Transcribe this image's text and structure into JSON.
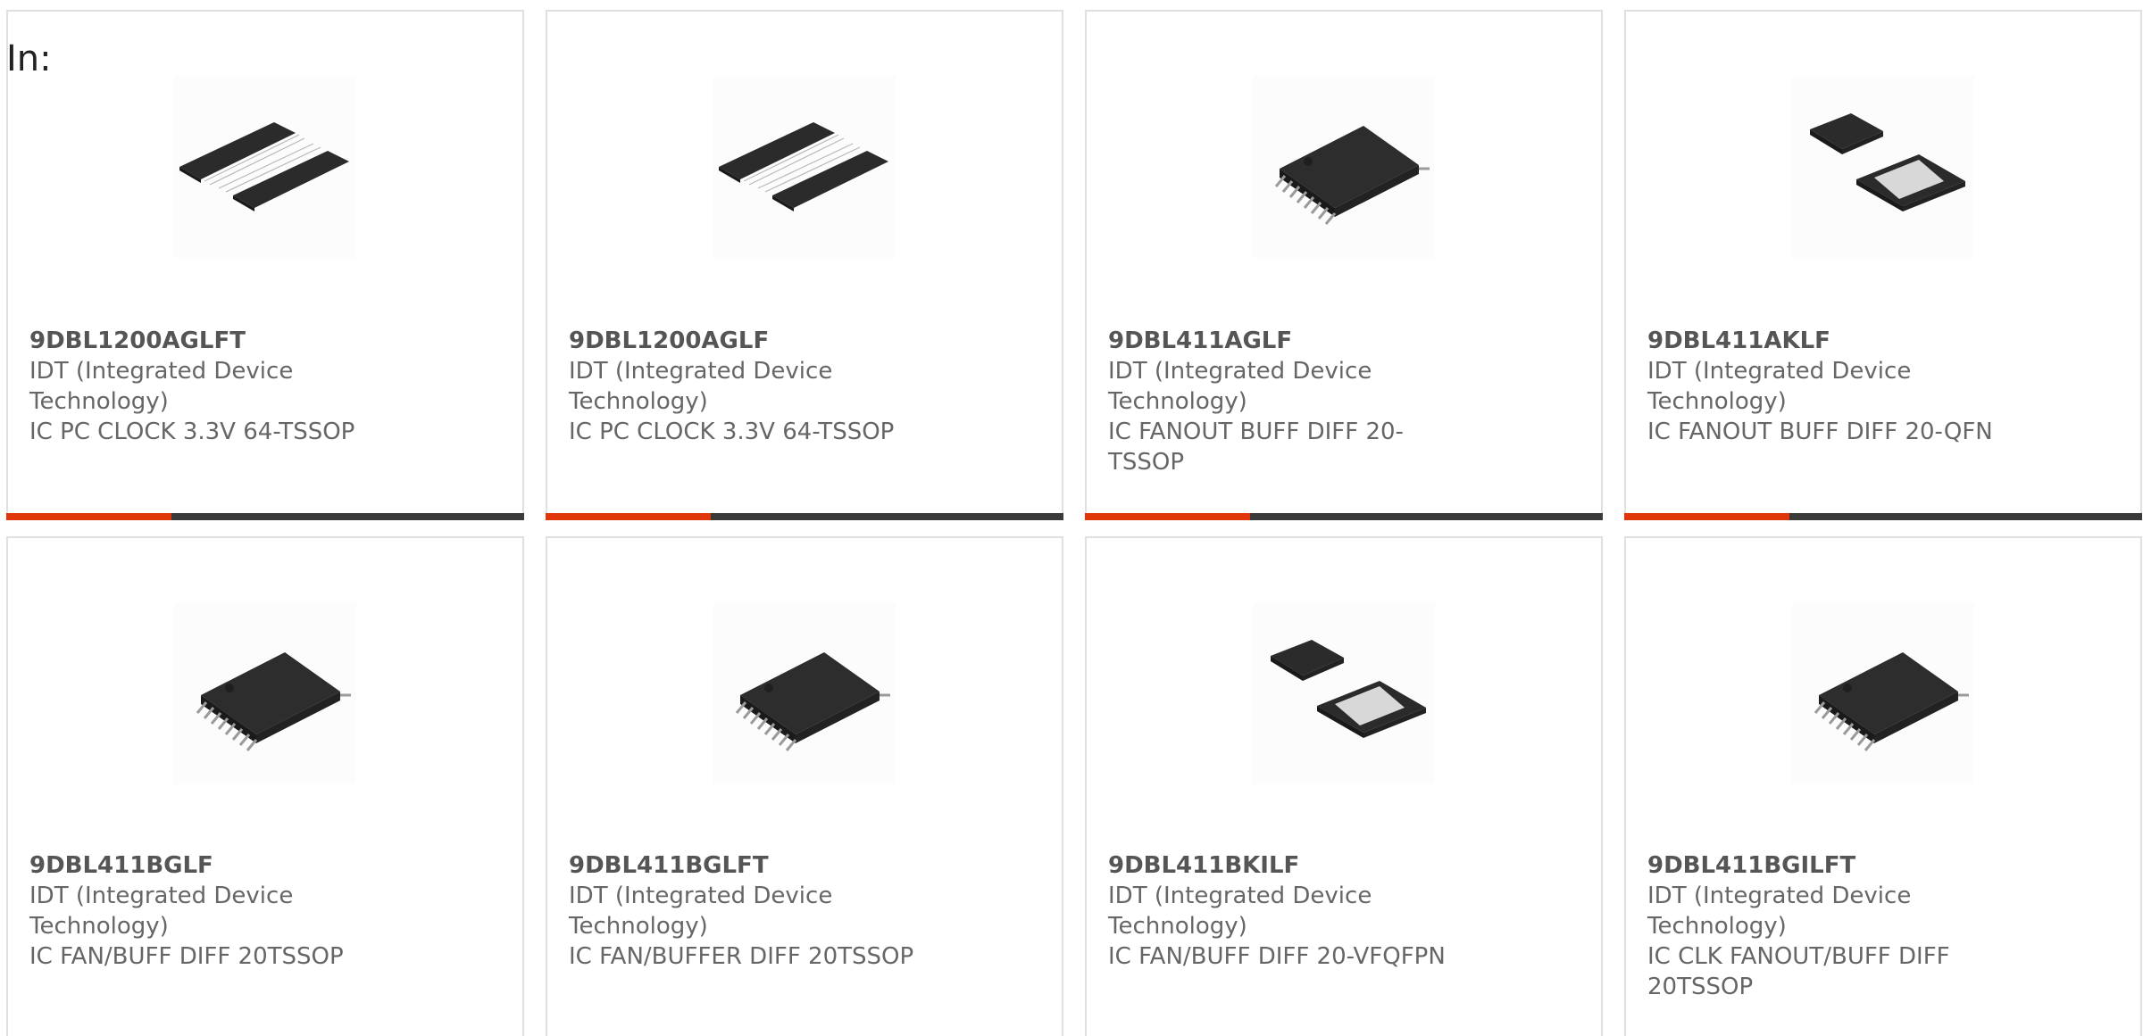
{
  "header": {
    "label": "In:"
  },
  "colors": {
    "accent": "#e0360a",
    "bar": "#3a3a3a",
    "border": "#e0e0e0"
  },
  "products": [
    {
      "part": "9DBL1200AGLFT",
      "manufacturer": "IDT (Integrated Device Technology)",
      "description": "IC PC CLOCK 3.3V 64-TSSOP",
      "package_icon": "tssop-64-icon"
    },
    {
      "part": "9DBL1200AGLF",
      "manufacturer": "IDT (Integrated Device Technology)",
      "description": "IC PC CLOCK 3.3V 64-TSSOP",
      "package_icon": "tssop-64-icon"
    },
    {
      "part": "9DBL411AGLF",
      "manufacturer": "IDT (Integrated Device Technology)",
      "description": "IC FANOUT BUFF DIFF 20-TSSOP",
      "package_icon": "tssop-20-icon"
    },
    {
      "part": "9DBL411AKLF",
      "manufacturer": "IDT (Integrated Device Technology)",
      "description": "IC FANOUT BUFF DIFF 20-QFN",
      "package_icon": "qfn-20-icon"
    },
    {
      "part": "9DBL411BGLF",
      "manufacturer": "IDT (Integrated Device Technology)",
      "description": "IC FAN/BUFF DIFF 20TSSOP",
      "package_icon": "tssop-20-icon"
    },
    {
      "part": "9DBL411BGLFT",
      "manufacturer": "IDT (Integrated Device Technology)",
      "description": "IC FAN/BUFFER DIFF 20TSSOP",
      "package_icon": "tssop-20-icon"
    },
    {
      "part": "9DBL411BKILF",
      "manufacturer": "IDT (Integrated Device Technology)",
      "description": "IC FAN/BUFF DIFF 20-VFQFPN",
      "package_icon": "qfn-20-icon"
    },
    {
      "part": "9DBL411BGILFT",
      "manufacturer": "IDT (Integrated Device Technology)",
      "description": "IC CLK FANOUT/BUFF DIFF 20TSSOP",
      "package_icon": "tssop-20-icon"
    }
  ]
}
